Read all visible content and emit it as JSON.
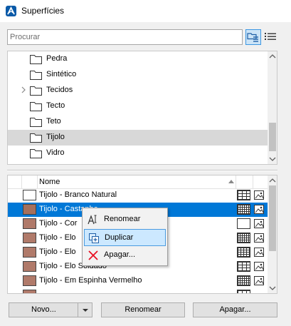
{
  "window": {
    "title": "Superfícies"
  },
  "search": {
    "placeholder": "Procurar",
    "value": ""
  },
  "tree": {
    "items": [
      {
        "label": "Pedra",
        "expandable": false,
        "selected": false
      },
      {
        "label": "Sintético",
        "expandable": false,
        "selected": false
      },
      {
        "label": "Tecidos",
        "expandable": true,
        "selected": false
      },
      {
        "label": "Tecto",
        "expandable": false,
        "selected": false
      },
      {
        "label": "Teto",
        "expandable": false,
        "selected": false
      },
      {
        "label": "Tijolo",
        "expandable": false,
        "selected": true
      },
      {
        "label": "Vidro",
        "expandable": false,
        "selected": false
      }
    ]
  },
  "table": {
    "header": {
      "name": "Nome"
    },
    "rows": [
      {
        "label": "Tijolo - Branco Natural",
        "color": "#ffffff",
        "pattern": "brick",
        "selected": false
      },
      {
        "label": "Tijolo - Castanho",
        "color": "#a5705c",
        "pattern": "dense",
        "selected": true
      },
      {
        "label": "Tijolo - Cor",
        "color": "#b07a6a",
        "pattern": "empty",
        "selected": false
      },
      {
        "label": "Tijolo - Elo",
        "color": "#b07a6a",
        "pattern": "dense",
        "selected": false
      },
      {
        "label": "Tijolo - Elo",
        "color": "#b07a6a",
        "pattern": "grid",
        "selected": false
      },
      {
        "label": "Tijolo - Elo Soldado",
        "color": "#b07a6a",
        "pattern": "brick",
        "selected": false
      },
      {
        "label": "Tijolo - Em Espinha Vermelho",
        "color": "#b07a6a",
        "pattern": "dense",
        "selected": false
      },
      {
        "label": "",
        "color": "#b07a6a",
        "pattern": "brick",
        "selected": false
      }
    ]
  },
  "context_menu": {
    "items": [
      {
        "label": "Renomear",
        "icon": "rename-icon",
        "highlighted": false
      },
      {
        "label": "Duplicar",
        "icon": "duplicate-icon",
        "highlighted": true
      },
      {
        "label": "Apagar...",
        "icon": "delete-x-icon",
        "highlighted": false
      }
    ]
  },
  "buttons": {
    "new": "Novo...",
    "rename": "Renomear",
    "delete": "Apagar..."
  },
  "colors": {
    "selection": "#0078d7",
    "menu_highlight": "#cce8ff",
    "delete_red": "#e81123",
    "app_icon": "#0a5aa8"
  }
}
